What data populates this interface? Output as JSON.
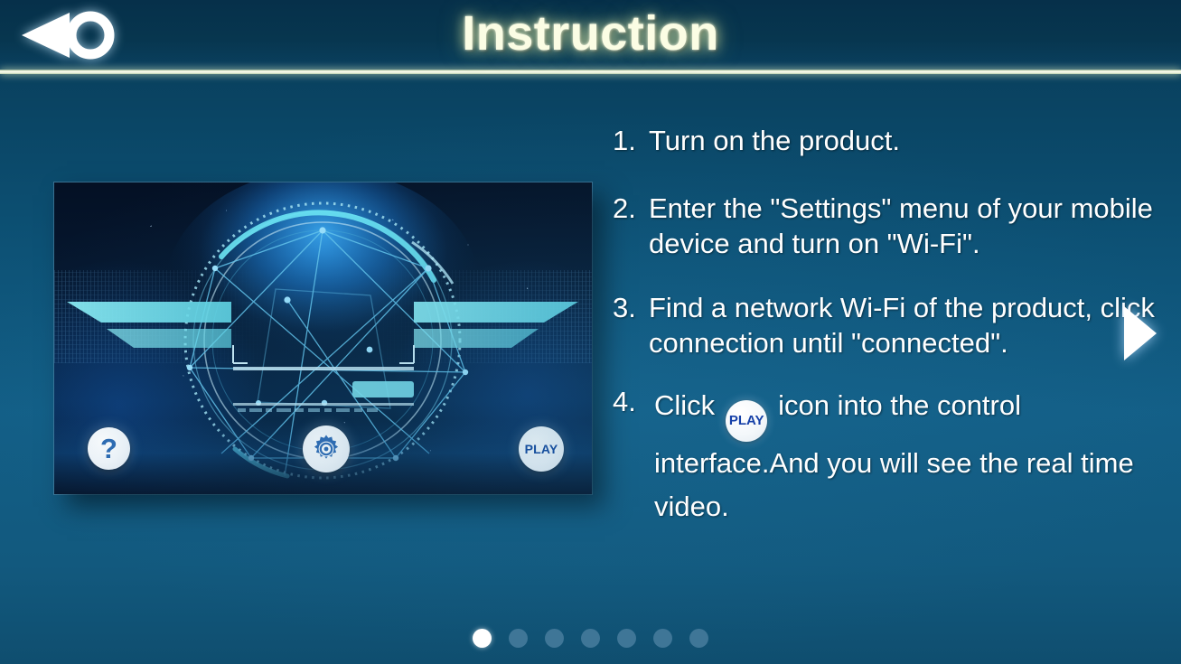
{
  "header": {
    "title": "Instruction",
    "back_icon": "back-arrow-ring-icon",
    "title_color": "#fbfde4",
    "rule_color": "#fdfff0",
    "bar_color": "#07364f"
  },
  "screenshot_panel": {
    "alt": "product control app HUD screen",
    "buttons": [
      {
        "name": "help-button",
        "label": "?"
      },
      {
        "name": "settings-button",
        "label": ""
      },
      {
        "name": "play-button",
        "label": "PLAY"
      }
    ]
  },
  "steps": [
    {
      "num": "1.",
      "text": "Turn on the product."
    },
    {
      "num": "2.",
      "text": "Enter the \"Settings\" menu of your mobile device and turn on \"Wi-Fi\"."
    },
    {
      "num": "3.",
      "text": "Find a network Wi-Fi of the product, click connection until \"connected\"."
    },
    {
      "num": "4.",
      "text_before": "Click",
      "inline_icon_label": "PLAY",
      "text_after": "icon into the control interface.And you will see the real time video."
    }
  ],
  "nav": {
    "next_icon": "next-arrow-icon"
  },
  "pagination": {
    "total": 7,
    "active_index": 1,
    "active_color": "#ffffff",
    "inactive_color": "#3f7697"
  },
  "theme": {
    "background_top": "#073247",
    "background_mid": "#135f87",
    "text_color": "#ffffff",
    "accent_cyan": "#7fe3f0"
  }
}
